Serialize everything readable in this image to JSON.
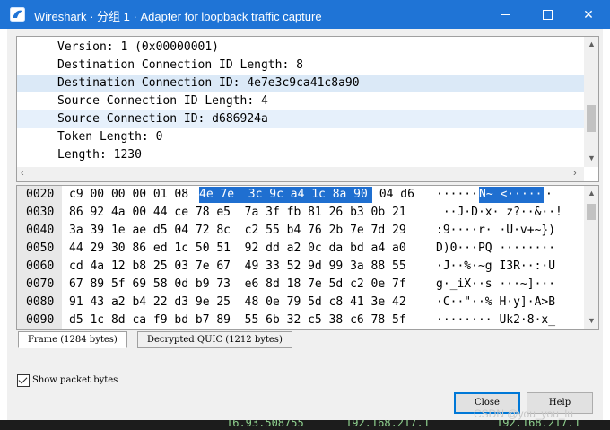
{
  "window": {
    "title": "Wireshark · 分组 1 · Adapter for loopback traffic capture"
  },
  "tree": {
    "lines": [
      "Version: 1 (0x00000001)",
      "Destination Connection ID Length: 8",
      "Destination Connection ID: 4e7e3c9ca41c8a90",
      "Source Connection ID Length: 4",
      "Source Connection ID: d686924a",
      "Token Length: 0",
      "Length: 1230"
    ],
    "selected_index": 2
  },
  "bytes": {
    "rows": [
      {
        "offset": "0020",
        "hex_pre": "c9 00 00 00 01 08 ",
        "hex_sel": "4e 7e  3c 9c a4 1c 8a 90",
        "hex_post": " 04 d6",
        "ascii_pre": "······",
        "ascii_sel": "N~ <·····",
        "ascii_post": "·"
      },
      {
        "offset": "0030",
        "hex": "86 92 4a 00 44 ce 78 e5  7a 3f fb 81 26 b3 0b 21",
        "ascii": " ··J·D·x· z?··&··!"
      },
      {
        "offset": "0040",
        "hex": "3a 39 1e ae d5 04 72 8c  c2 55 b4 76 2b 7e 7d 29",
        "ascii": ":9····r· ·U·v+~})"
      },
      {
        "offset": "0050",
        "hex": "44 29 30 86 ed 1c 50 51  92 dd a2 0c da bd a4 a0",
        "ascii": "D)0···PQ ········"
      },
      {
        "offset": "0060",
        "hex": "cd 4a 12 b8 25 03 7e 67  49 33 52 9d 99 3a 88 55",
        "ascii": "·J··%·~g I3R··:·U"
      },
      {
        "offset": "0070",
        "hex": "67 89 5f 69 58 0d b9 73  e6 8d 18 7e 5d c2 0e 7f",
        "ascii": "g·_iX··s ···~]···"
      },
      {
        "offset": "0080",
        "hex": "91 43 a2 b4 22 d3 9e 25  48 0e 79 5d c8 41 3e 42",
        "ascii": "·C··\"··% H·y]·A>B"
      },
      {
        "offset": "0090",
        "hex": "d5 1c 8d ca f9 bd b7 89  55 6b 32 c5 38 c6 78 5f",
        "ascii": "········ Uk2·8·x_"
      }
    ]
  },
  "tabs": [
    "Frame (1284 bytes)",
    "Decrypted QUIC (1212 bytes)"
  ],
  "options": {
    "show_packet_bytes_label": "Show packet bytes",
    "show_packet_bytes_checked": true
  },
  "buttons": {
    "close": "Close",
    "help": "Help"
  },
  "background_text": [
    "16.93.508755",
    "192.168.217.1",
    "192.168.217.1"
  ],
  "watermark": "CSDN @you_you_lu",
  "colors": {
    "titlebar": "#1f74d6",
    "selection": "#1f6fd0",
    "tree_highlight": "#dbe9f7"
  }
}
